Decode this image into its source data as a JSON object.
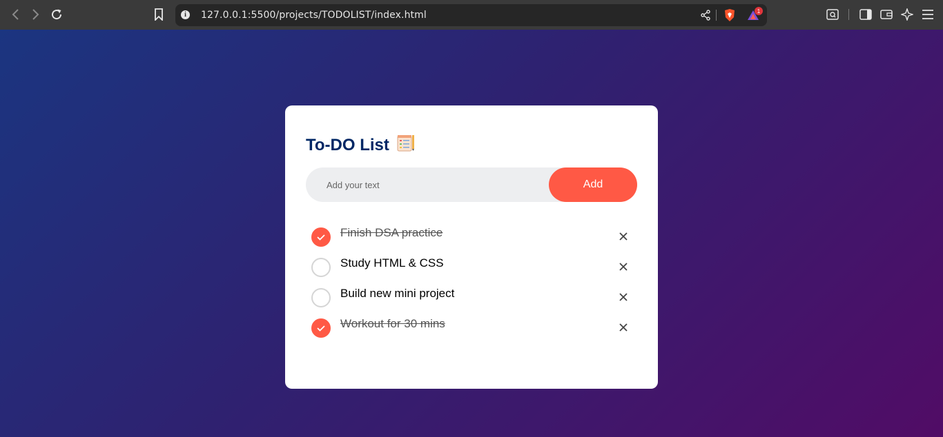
{
  "browser": {
    "url": "127.0.0.1:5500/projects/TODOLIST/index.html",
    "notification_count": "1"
  },
  "app": {
    "title": "To-DO List",
    "title_icon": "notepad-icon",
    "input_placeholder": "Add your text",
    "add_label": "Add",
    "accent_color": "#ff5945",
    "title_color": "#002765"
  },
  "tasks": [
    {
      "text": "Finish DSA practice",
      "done": true
    },
    {
      "text": "Study HTML & CSS",
      "done": false
    },
    {
      "text": "Build new mini project",
      "done": false
    },
    {
      "text": "Workout for 30 mins",
      "done": true
    }
  ]
}
